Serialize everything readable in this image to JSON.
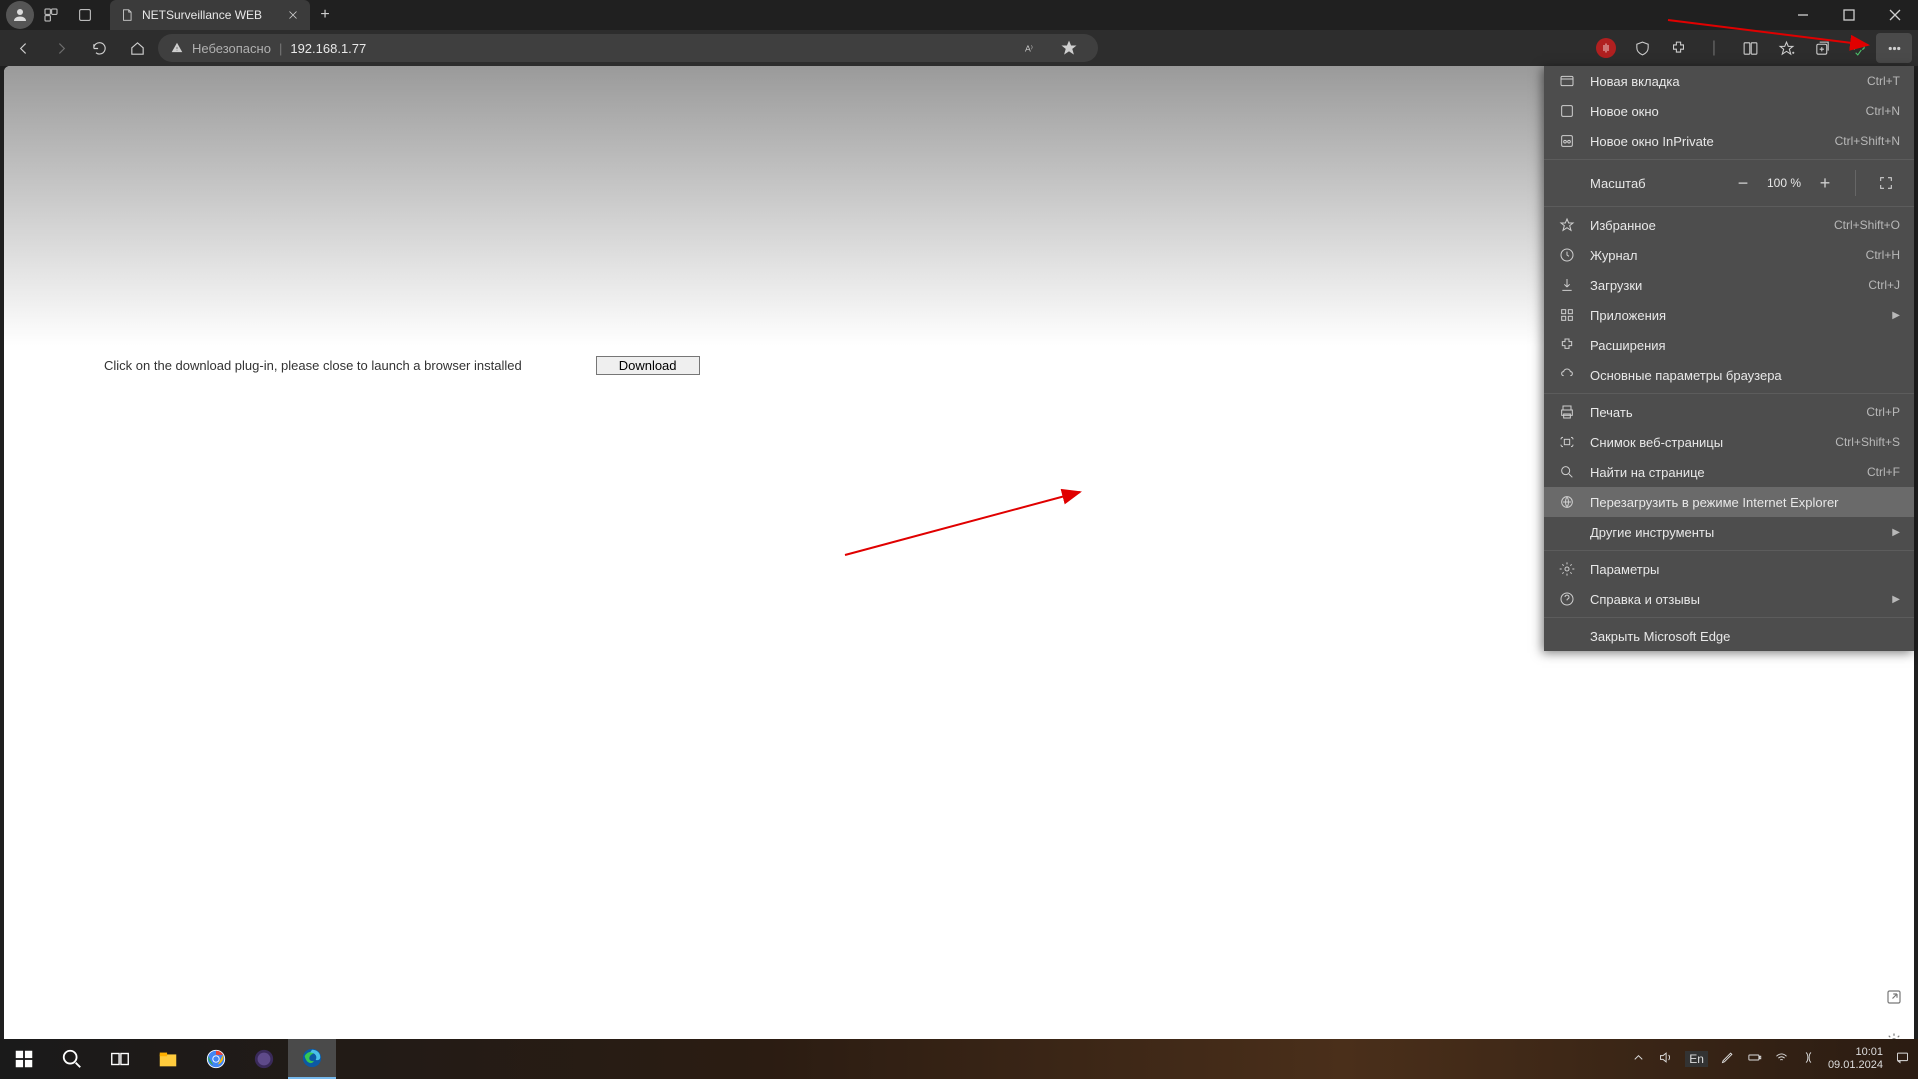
{
  "tab": {
    "title": "NETSurveillance WEB"
  },
  "addressbar": {
    "security_label": "Небезопасно",
    "url": "192.168.1.77"
  },
  "page": {
    "plugin_text": "Click on the download plug-in, please close to launch a browser installed",
    "download_btn": "Download"
  },
  "menu": {
    "new_tab": "Новая вкладка",
    "new_tab_sc": "Ctrl+T",
    "new_window": "Новое окно",
    "new_window_sc": "Ctrl+N",
    "new_inprivate": "Новое окно InPrivate",
    "new_inprivate_sc": "Ctrl+Shift+N",
    "zoom_label": "Масштаб",
    "zoom_value": "100 %",
    "favorites": "Избранное",
    "favorites_sc": "Ctrl+Shift+O",
    "history": "Журнал",
    "history_sc": "Ctrl+H",
    "downloads": "Загрузки",
    "downloads_sc": "Ctrl+J",
    "apps": "Приложения",
    "extensions": "Расширения",
    "browser_essentials": "Основные параметры браузера",
    "print": "Печать",
    "print_sc": "Ctrl+P",
    "web_capture": "Снимок веб-страницы",
    "web_capture_sc": "Ctrl+Shift+S",
    "find": "Найти на странице",
    "find_sc": "Ctrl+F",
    "reload_ie": "Перезагрузить в режиме Internet Explorer",
    "more_tools": "Другие инструменты",
    "settings": "Параметры",
    "help": "Справка и отзывы",
    "close_edge": "Закрыть Microsoft Edge"
  },
  "tray": {
    "lang": "En",
    "time": "10:01",
    "date": "09.01.2024"
  }
}
